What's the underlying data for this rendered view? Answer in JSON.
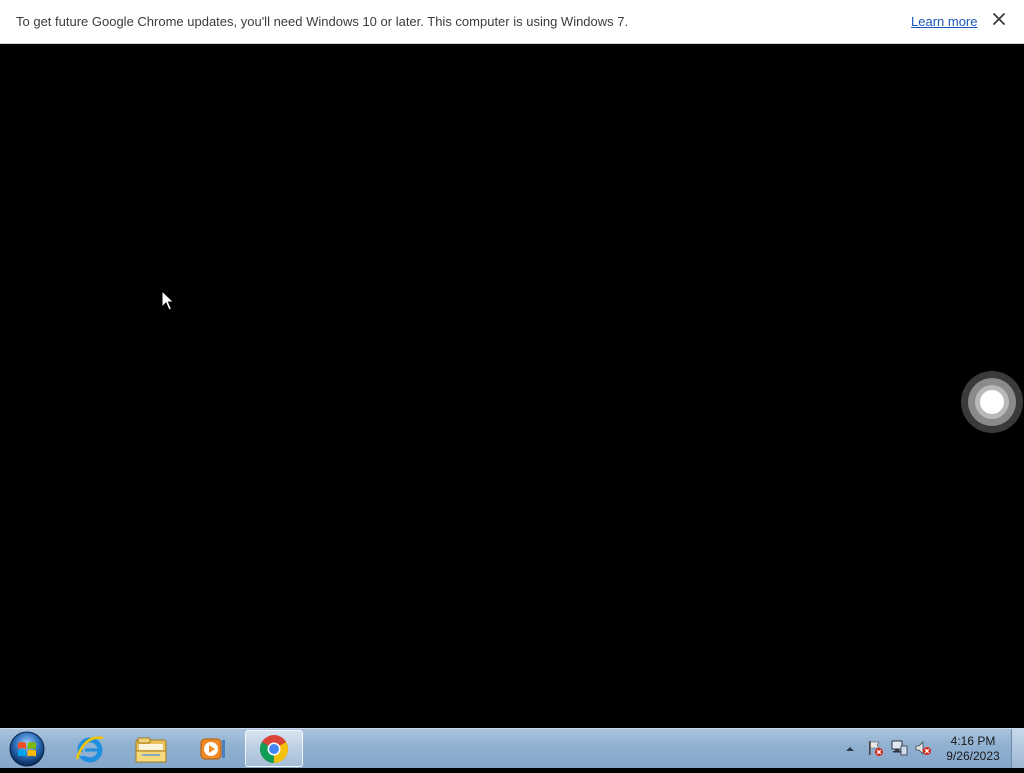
{
  "infobar": {
    "message": "To get future Google Chrome updates, you'll need Windows 10 or later. This computer is using Windows 7.",
    "learn_more": "Learn more",
    "close_icon": "close-icon"
  },
  "content": {
    "background": "#000000",
    "cursor_icon": "mouse-pointer-icon",
    "floating_button_icon": "circle-icon"
  },
  "taskbar": {
    "start_icon": "windows-start-icon",
    "pinned": [
      {
        "name": "internet-explorer",
        "icon": "ie-icon"
      },
      {
        "name": "windows-explorer",
        "icon": "folder-icon"
      },
      {
        "name": "media-player",
        "icon": "media-player-icon"
      },
      {
        "name": "google-chrome",
        "icon": "chrome-icon",
        "active": true
      }
    ],
    "tray": {
      "show_hidden_icon": "chevron-up-icon",
      "icons": [
        "action-center-flag-icon",
        "network-icon",
        "volume-muted-icon"
      ]
    },
    "clock": {
      "time": "4:16 PM",
      "date": "9/26/2023"
    }
  }
}
